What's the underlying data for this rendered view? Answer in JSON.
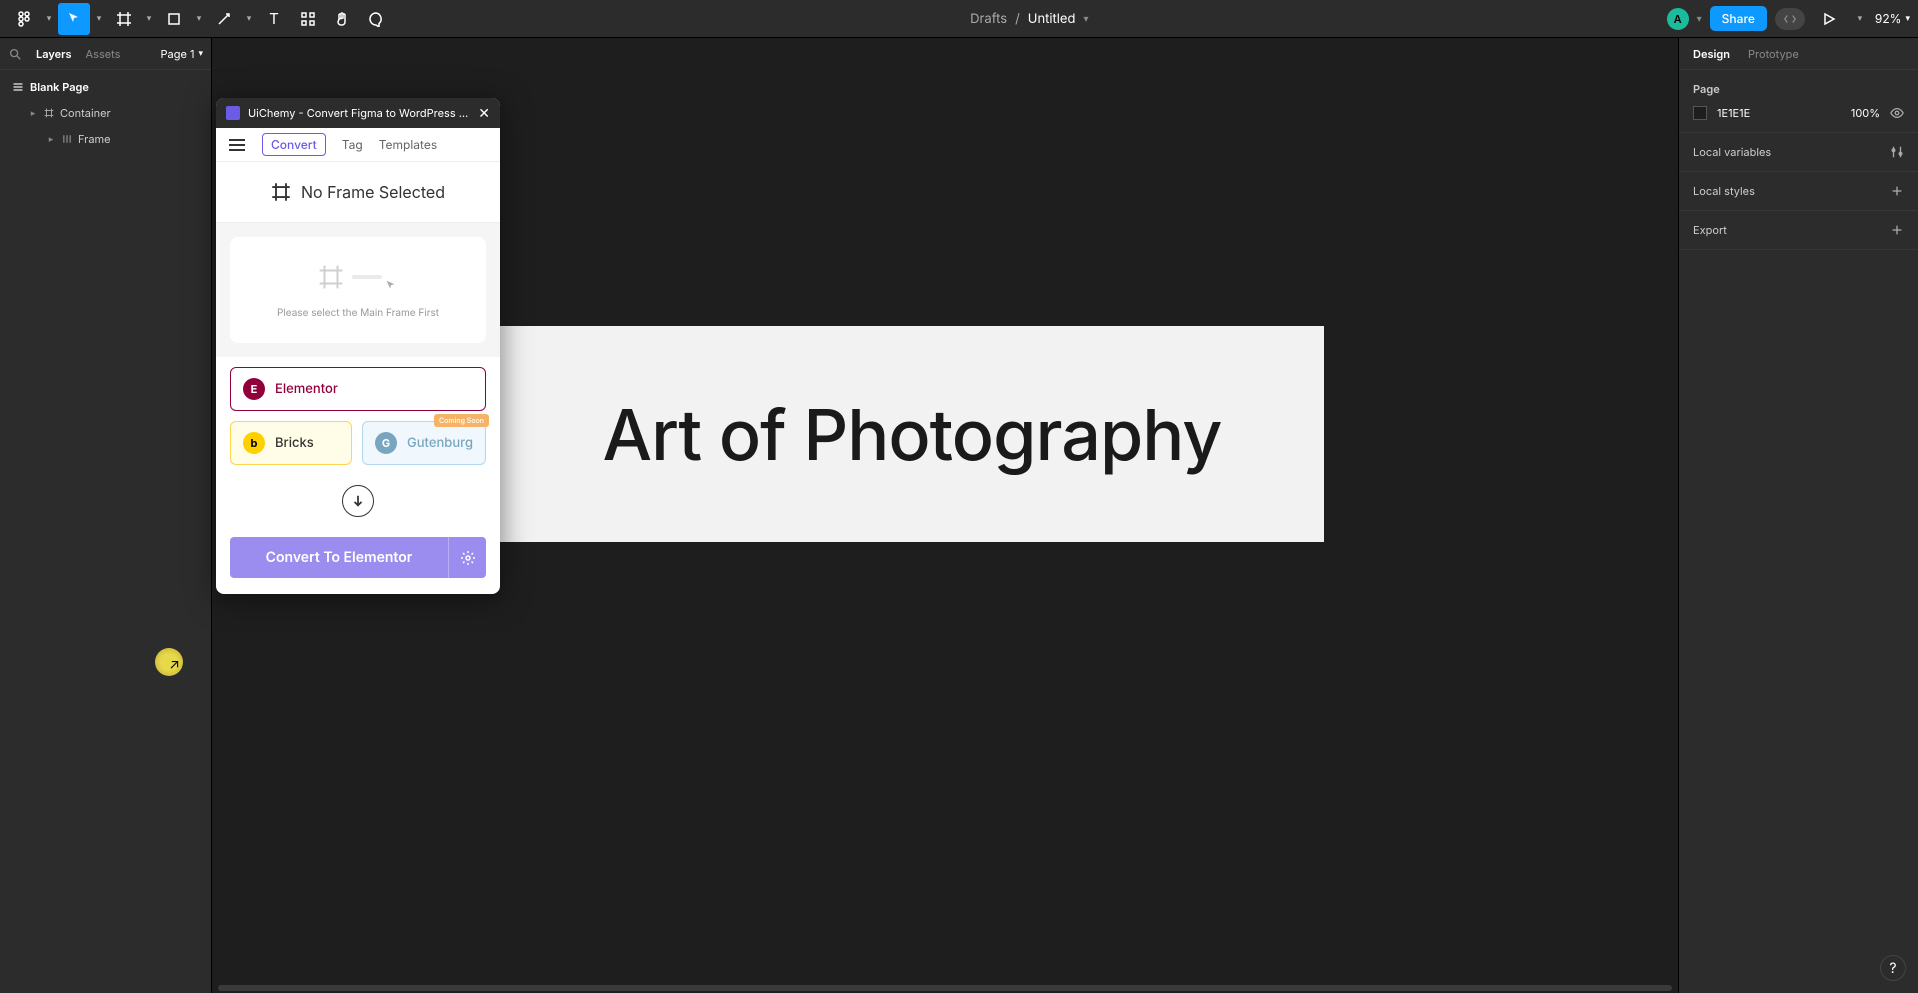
{
  "toolbar": {
    "location": "Drafts",
    "doc_title": "Untitled",
    "avatar_initial": "A",
    "share": "Share",
    "zoom": "92%"
  },
  "left_panel": {
    "tabs": {
      "layers": "Layers",
      "assets": "Assets"
    },
    "page": "Page 1",
    "layers": [
      {
        "name": "Blank Page",
        "level": 0
      },
      {
        "name": "Container",
        "level": 1
      },
      {
        "name": "Frame",
        "level": 2
      }
    ]
  },
  "canvas": {
    "headline": "Art of Photography"
  },
  "right_panel": {
    "tabs": {
      "design": "Design",
      "prototype": "Prototype"
    },
    "page_section": "Page",
    "page_color": "1E1E1E",
    "page_opacity": "100%",
    "local_variables": "Local variables",
    "local_styles": "Local styles",
    "export": "Export"
  },
  "plugin": {
    "title": "UiChemy - Convert Figma to WordPress ( Elemento...",
    "tabs": {
      "convert": "Convert",
      "tag": "Tag",
      "templates": "Templates"
    },
    "no_frame": "No Frame Selected",
    "preview_hint": "Please select the Main Frame First",
    "builders": {
      "elementor": "Elementor",
      "bricks": "Bricks",
      "gutenberg": "Gutenburg",
      "coming_soon": "Coming Soon"
    },
    "convert_btn": "Convert To Elementor"
  }
}
